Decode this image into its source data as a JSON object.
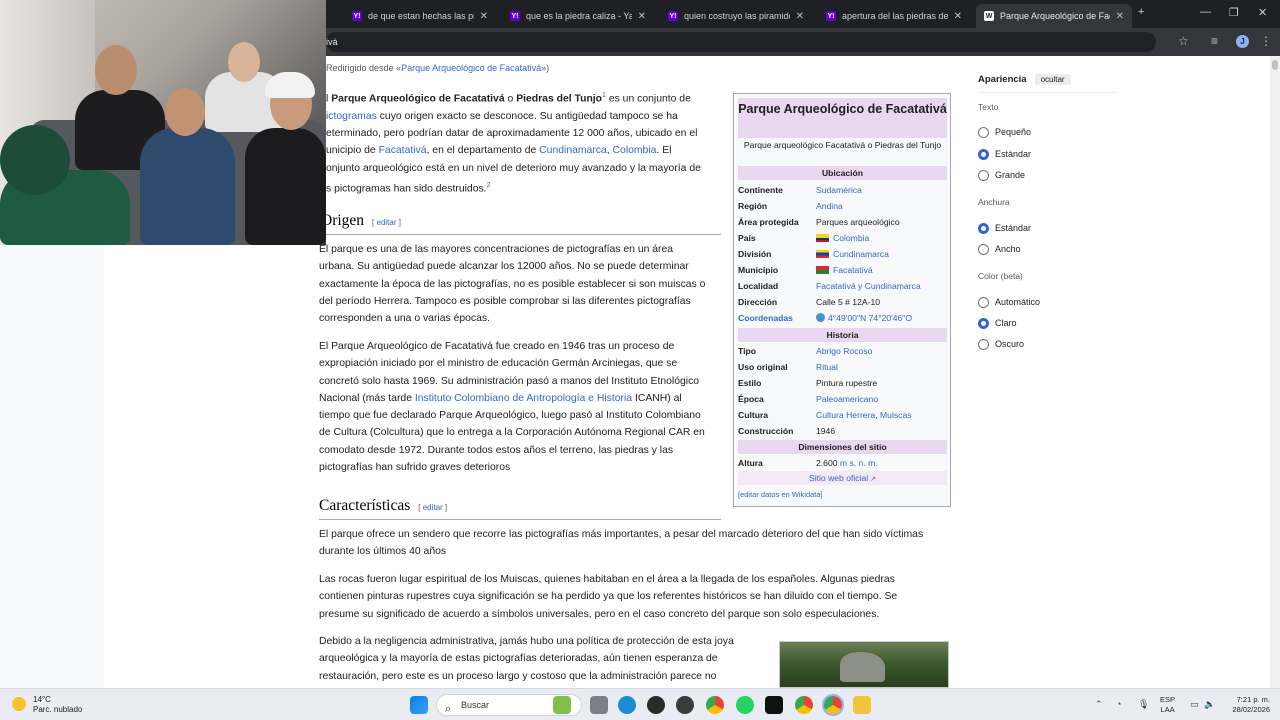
{
  "browser": {
    "tabs": [
      {
        "label": "de que estan hechas las piramid",
        "favicon": "Y!",
        "active": false
      },
      {
        "label": "que es la piedra caliza - Yahoo",
        "favicon": "Y!",
        "active": false
      },
      {
        "label": "quien costruyo las piramides -",
        "favicon": "Y!",
        "active": false
      },
      {
        "label": "apertura del las piedras de tu",
        "favicon": "Y!",
        "active": false
      },
      {
        "label": "Parque Arqueológico de Facatat",
        "favicon": "W",
        "active": true
      }
    ],
    "new_tab": "+",
    "url": "ivá",
    "profile_initial": "J"
  },
  "article": {
    "redirect_prefix": "Redirigido desde «",
    "redirect_link": "Parque Arqueológico de Facatativá",
    "redirect_suffix": "»)",
    "intro": {
      "l1_a": "l ",
      "l1_b1": "Parque Arqueológico de Facatativá",
      "l1_c": " o ",
      "l1_b2": "Piedras del Tunjo",
      "l1_sup": "1",
      "l1_d": " es un conjunto de",
      "l2_link": "ictogramas",
      "l2_rest": " cuyo origen exacto se desconoce. Su antigüedad tampoco se ha",
      "l3": "eterminado, pero podrían datar de aproximadamente 12 000 años, ubicado en el",
      "l4_a": "unicipio de ",
      "l4_link1": "Facatativá",
      "l4_b": ", en el departamento de ",
      "l4_link2": "Cundinamarca",
      "l4_c": ", ",
      "l4_link3": "Colombia",
      "l4_d": ". El",
      "l5": "onjunto arqueológico está en un nivel de deterioro muy avanzado y la mayoría de",
      "l6": "s pictogramas han sido destruidos.",
      "l6_sup": "2"
    },
    "origen": {
      "heading": "Origen",
      "edit": "editar",
      "p1": [
        "El parque es una de las mayores concentraciones de pictografías en un área",
        "urbana. Su antigüedad puede alcanzar los 12000 años. No se puede determinar",
        "exactamente la época de las pictografías, no es posible establecer si son muiscas o",
        "del período Herrera. Tampoco es posible comprobar si las diferentes pictografías",
        "corresponden a una o varias épocas."
      ],
      "p2": [
        "El Parque Arqueológico de Facatativá fue creado en 1946 tras un proceso de",
        "expropiación iniciado por el ministro de educación Germán Arciniegas, que se",
        "concretó solo hasta 1969. Su administración pasó a manos del Instituto Etnológico",
        "tiempo que fue declarado Parque Arqueológico, luego pasó al Instituto Colombiano",
        "de Cultura (Colcultura) que lo entrega a la Corporación Autónoma Regional CAR en",
        "comodato desde 1972. Durante todos estos años el terreno, las piedras y las",
        "pictografías han sufrido graves deterioros"
      ],
      "p2_l4_a": "Nacional (más tarde ",
      "p2_l4_link": "Instituto Colombiano de Antropología e Historia",
      "p2_l4_b": " ICANH) al"
    },
    "caracteristicas": {
      "heading": "Características",
      "edit": "editar",
      "p1": [
        "El parque ofrece un sendero que recorre las pictografías más importantes, a pesar del marcado deterioro del que han sido víctimas",
        "durante los últimos 40 años"
      ],
      "p2": [
        "Las rocas fueron lugar espiritual de los Muiscas, quienes habitaban en el área a la llegada de los españoles. Algunas piedras",
        "contienen pinturas rupestres cuya significación se ha perdido ya que los referentes históricos se han diluido con el tiempo. Se",
        "presume su significado de acuerdo a símbolos universales, pero en el caso concreto del parque son solo especulaciones."
      ],
      "p3": [
        "Debido a la negligencia administrativa, jamás hubo una política de protección de esta joya",
        "arqueológica y la mayoría de estas pictografías deterioradas, aún tienen esperanza de",
        "restauración, pero este es un proceso largo y costoso que la administración parece no"
      ]
    }
  },
  "infobox": {
    "title": "Parque Arqueológico de Facatativá",
    "caption": "Parque arqueológico Facatativá o Piedras del Tunjo",
    "ubicacion": "Ubicación",
    "rows1": [
      {
        "k": "Continente",
        "v": "Sudamérica",
        "link": true
      },
      {
        "k": "Región",
        "v": "Andina",
        "link": true
      },
      {
        "k": "Área protegida",
        "v": "Parques arqueológico",
        "link": false
      },
      {
        "k": "País",
        "v": "Colombia",
        "link": true,
        "flag": "colombia"
      },
      {
        "k": "División",
        "v": "Cundinamarca",
        "link": true,
        "flag": "cundinamarca"
      },
      {
        "k": "Municipio",
        "v": "Facatativá",
        "link": true,
        "flag": "facatativa"
      },
      {
        "k": "Localidad",
        "v": "Facatativá y Cundinamarca",
        "link": true
      },
      {
        "k": "Dirección",
        "v": "Calle 5 # 12A-10",
        "link": false
      },
      {
        "k": "Coordenadas",
        "v": "4°49′00″N 74°20′46″O",
        "link": true,
        "globe": true
      }
    ],
    "historia": "Historia",
    "rows2": [
      {
        "k": "Tipo",
        "v": "Abrigo Rocoso",
        "link": true
      },
      {
        "k": "Uso original",
        "v": "Ritual",
        "link": true
      },
      {
        "k": "Estilo",
        "v": "Pintura rupestre",
        "link": false
      },
      {
        "k": "Época",
        "v": "Paleoamericano",
        "link": true
      },
      {
        "k": "Cultura",
        "v1": "Cultura Herrera",
        "sep": ", ",
        "v2": "Muiscas",
        "link": true
      },
      {
        "k": "Construcción",
        "v": "1946",
        "link": false
      }
    ],
    "dimensiones": "Dimensiones del sitio",
    "altura_k": "Altura",
    "altura_v": "2.600 ",
    "altura_unit": "m s. n. m.",
    "website": "Sitio web oficial",
    "wikidata": "[editar datos en Wikidata]"
  },
  "appearance": {
    "title": "Apariencia",
    "hide": "ocultar",
    "texto": "Texto",
    "texto_opts": [
      "Pequeño",
      "Estándar",
      "Grande"
    ],
    "texto_selected": 1,
    "anchura": "Anchura",
    "anchura_opts": [
      "Estándar",
      "Ancho"
    ],
    "anchura_selected": 0,
    "color": "Color (beta)",
    "color_opts": [
      "Automático",
      "Claro",
      "Oscuro"
    ],
    "color_selected": 1
  },
  "taskbar": {
    "temp": "14°C",
    "weather": "Parc. nublado",
    "search": "Buscar",
    "lang1": "ESP",
    "lang2": "LAA",
    "time": "7:21 p. m.",
    "date": "28/02/2026"
  },
  "colors": {
    "link": "#3366cc",
    "accent": "#e8d7ee",
    "taskbar": "#e9edf3"
  }
}
